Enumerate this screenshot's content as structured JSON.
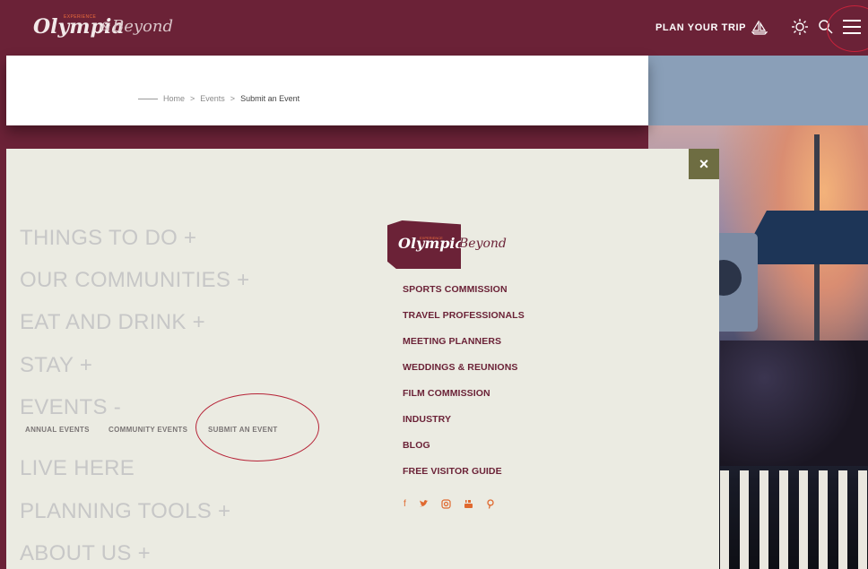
{
  "header": {
    "logo": {
      "experience": "EXPERIENCE",
      "olympia": "Olympia",
      "amp": "&",
      "beyond": "Beyond"
    },
    "plan_trip": "PLAN YOUR TRIP",
    "icons": [
      "sun-icon",
      "search-icon",
      "menu-icon"
    ]
  },
  "breadcrumb": {
    "items": [
      "Home",
      "Events",
      "Submit an Event"
    ],
    "separator": ">"
  },
  "menu": {
    "close": "×",
    "nav": [
      "THINGS TO DO +",
      "OUR COMMUNITIES +",
      "EAT AND DRINK +",
      "STAY +",
      "EVENTS -",
      "LIVE HERE",
      "PLANNING TOOLS +",
      "ABOUT US +"
    ],
    "events_sub": [
      "ANNUAL EVENTS",
      "COMMUNITY EVENTS",
      "SUBMIT AN EVENT"
    ],
    "logo": {
      "experience": "EXPERIENCE",
      "olympia": "Olympia",
      "amp": "&",
      "beyond": "Beyond"
    },
    "links": [
      "SPORTS COMMISSION",
      "TRAVEL PROFESSIONALS",
      "MEETING PLANNERS",
      "WEDDINGS & REUNIONS",
      "FILM COMMISSION",
      "INDUSTRY",
      "BLOG",
      "FREE VISITOR GUIDE"
    ],
    "social": [
      "facebook-icon",
      "twitter-icon",
      "instagram-icon",
      "youtube-icon",
      "pinterest-icon"
    ]
  },
  "colors": {
    "brand": "#6b2237",
    "accent": "#e0692f",
    "panel": "#ebebe2",
    "close": "#6e6d42"
  }
}
